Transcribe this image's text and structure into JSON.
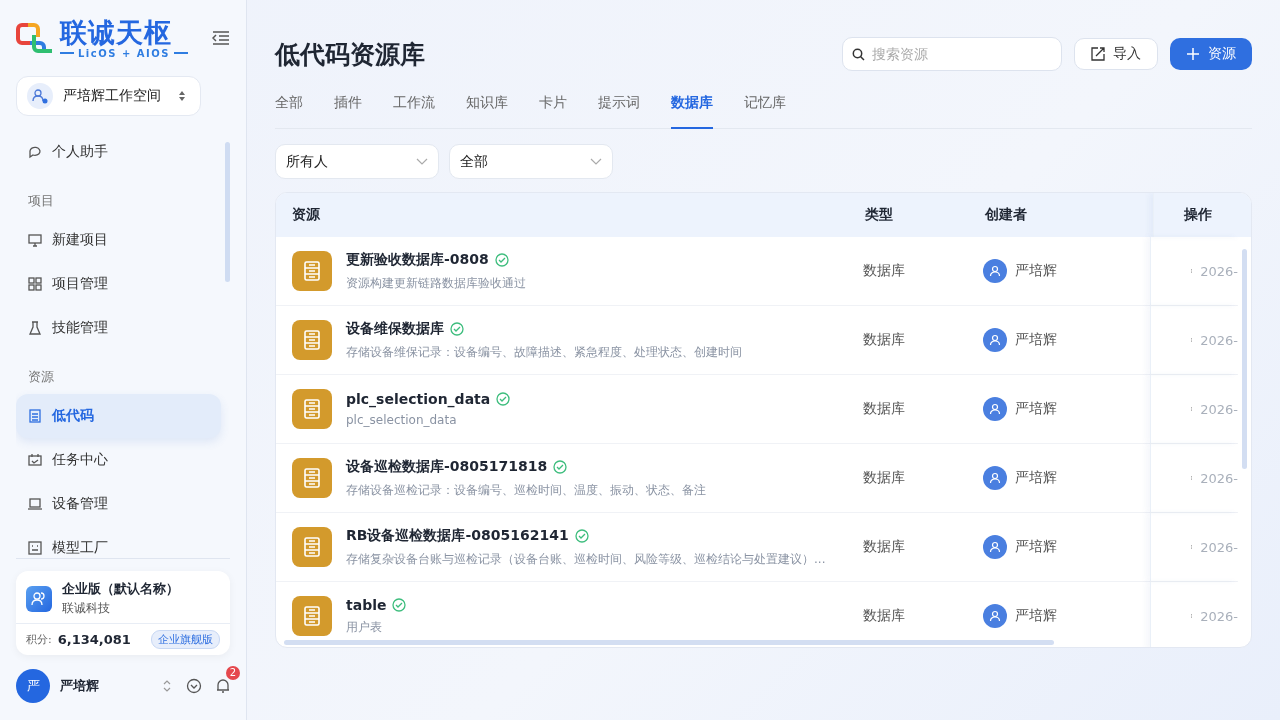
{
  "brand": {
    "name": "联诚天枢",
    "tagline": "LicOS + AIOS"
  },
  "workspace": {
    "name": "严培辉工作空间"
  },
  "nav": [
    {
      "kind": "item",
      "label": "个人助手",
      "selected": false
    },
    {
      "kind": "section",
      "label": "项目"
    },
    {
      "kind": "item",
      "label": "新建项目",
      "selected": false
    },
    {
      "kind": "item",
      "label": "项目管理",
      "selected": false
    },
    {
      "kind": "item",
      "label": "技能管理",
      "selected": false
    },
    {
      "kind": "section",
      "label": "资源"
    },
    {
      "kind": "item",
      "label": "低代码",
      "selected": true
    },
    {
      "kind": "item",
      "label": "任务中心",
      "selected": false
    },
    {
      "kind": "item",
      "label": "设备管理",
      "selected": false
    },
    {
      "kind": "item",
      "label": "模型工厂",
      "selected": false
    }
  ],
  "org": {
    "name": "企业版（默认名称）",
    "company": "联诚科技",
    "points_label": "积分:",
    "points": "6,134,081",
    "plan": "企业旗舰版"
  },
  "user": {
    "avatar": "严",
    "name": "严培辉",
    "notifications": "2"
  },
  "page": {
    "title": "低代码资源库",
    "search": {
      "placeholder": "搜索资源"
    },
    "import_label": "导入",
    "add_label": "资源"
  },
  "tabs": [
    {
      "label": "全部",
      "selected": false
    },
    {
      "label": "插件",
      "selected": false
    },
    {
      "label": "工作流",
      "selected": false
    },
    {
      "label": "知识库",
      "selected": false
    },
    {
      "label": "卡片",
      "selected": false
    },
    {
      "label": "提示词",
      "selected": false
    },
    {
      "label": "数据库",
      "selected": true
    },
    {
      "label": "记忆库",
      "selected": false
    }
  ],
  "filters": [
    {
      "value": "所有人"
    },
    {
      "value": "全部"
    }
  ],
  "table": {
    "columns": [
      "资源",
      "类型",
      "创建者",
      "操作"
    ],
    "rows": [
      {
        "name": "更新验收数据库-0808",
        "verified": true,
        "description": "资源构建更新链路数据库验收通过",
        "type": "数据库",
        "creator": "严培辉",
        "date": "2026-"
      },
      {
        "name": "设备维保数据库",
        "verified": true,
        "description": "存储设备维保记录：设备编号、故障描述、紧急程度、处理状态、创建时间",
        "type": "数据库",
        "creator": "严培辉",
        "date": "2026-"
      },
      {
        "name": "plc_selection_data",
        "verified": true,
        "description": "plc_selection_data",
        "type": "数据库",
        "creator": "严培辉",
        "date": "2026-"
      },
      {
        "name": "设备巡检数据库-0805171818",
        "verified": true,
        "description": "存储设备巡检记录：设备编号、巡检时间、温度、振动、状态、备注",
        "type": "数据库",
        "creator": "严培辉",
        "date": "2026-"
      },
      {
        "name": "RB设备巡检数据库-0805162141",
        "verified": true,
        "description": "存储复杂设备台账与巡检记录（设备台账、巡检时间、风险等级、巡检结论与处置建议）...",
        "type": "数据库",
        "creator": "严培辉",
        "date": "2026-"
      },
      {
        "name": "table",
        "verified": true,
        "description": "用户表",
        "type": "数据库",
        "creator": "严培辉",
        "date": "2026-"
      }
    ]
  }
}
